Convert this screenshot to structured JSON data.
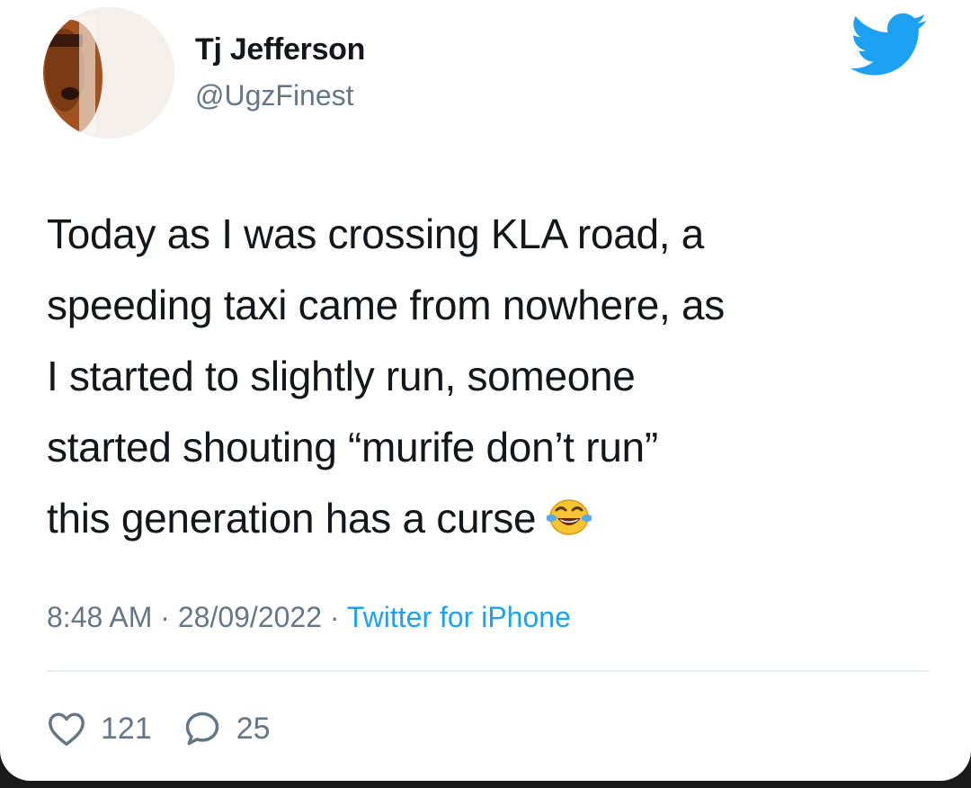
{
  "tweet": {
    "author": {
      "display_name": "Tj Jefferson",
      "handle": "@UgzFinest",
      "avatar_icon": "profile-photo"
    },
    "platform_icon": "twitter-bird-icon",
    "brand_color": "#1DA1F2",
    "text": "Today as I was crossing KLA road, a\nspeeding taxi came from nowhere, as\nI started to slightly run, someone\nstarted shouting “murife don’t run”\nthis generation has a curse",
    "text_emoji": "face-with-tears-of-joy",
    "time": "8:48 AM",
    "separator": "·",
    "date": "28/09/2022",
    "source": "Twitter for iPhone",
    "likes": "121",
    "replies": "25"
  }
}
